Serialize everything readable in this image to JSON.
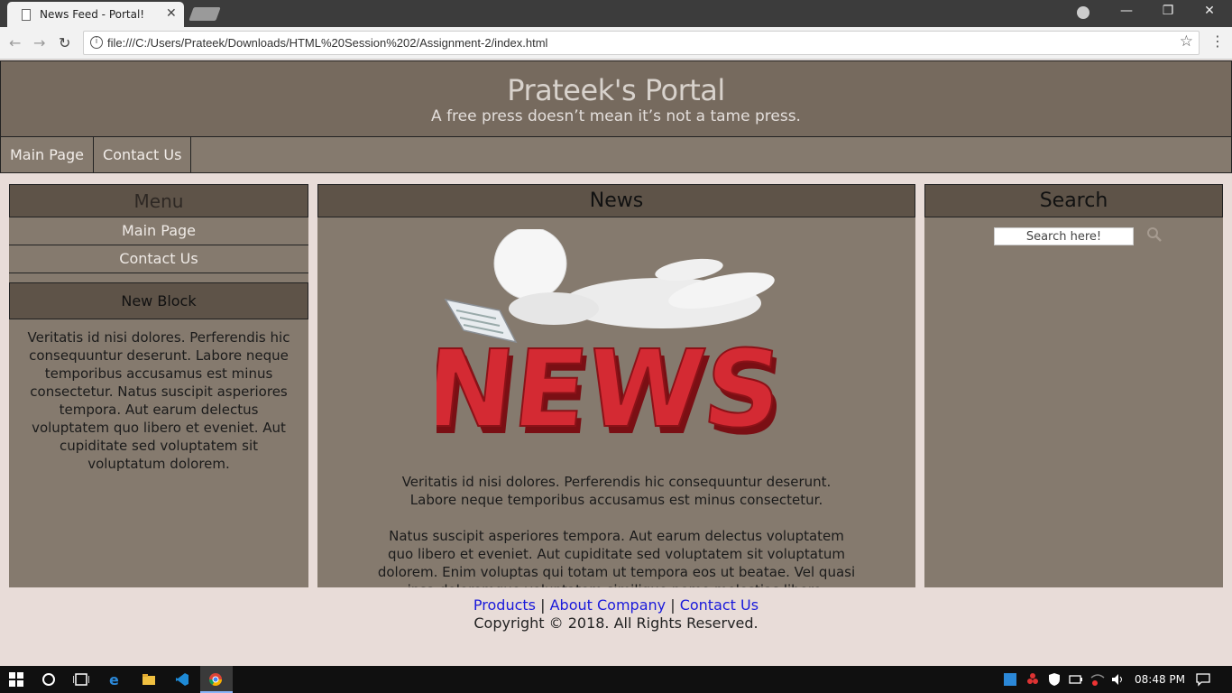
{
  "browser": {
    "tab_title": "News Feed - Portal!",
    "url": "file:///C:/Users/Prateek/Downloads/HTML%20Session%202/Assignment-2/index.html"
  },
  "site": {
    "title": "Prateek's Portal",
    "tagline": "A free press doesn’t mean it’s not a tame press."
  },
  "topnav": [
    "Main Page",
    "Contact Us"
  ],
  "left": {
    "menu_heading": "Menu",
    "menu_items": [
      "Main Page",
      "Contact Us"
    ],
    "block_heading": "New Block",
    "block_text": "Veritatis id nisi dolores. Perferendis hic consequuntur deserunt. Labore neque temporibus accusamus est minus consectetur. Natus suscipit asperiores tempora. Aut earum delectus voluptatem quo libero et eveniet. Aut cupiditate sed voluptatem sit voluptatum dolorem."
  },
  "main": {
    "heading": "News",
    "image_word": "NEWS",
    "paragraph1": "Veritatis id nisi dolores. Perferendis hic consequuntur deserunt. Labore neque temporibus accusamus est minus consectetur.",
    "paragraph2": "Natus suscipit asperiores tempora. Aut earum delectus voluptatem quo libero et eveniet. Aut cupiditate sed voluptatem sit voluptatum dolorem. Enim voluptas qui totam ut tempora eos ut beatae. Vel quasi ipsa doloremque voluptatem similique nemo molestias libero. Sapiente ipsum"
  },
  "search": {
    "heading": "Search",
    "placeholder": "Search here!"
  },
  "footer": {
    "links": [
      "Products",
      "About Company",
      "Contact Us"
    ],
    "separator": "|",
    "copyright": "Copyright © 2018. All Rights Reserved."
  },
  "taskbar": {
    "time": "08:48 PM"
  }
}
